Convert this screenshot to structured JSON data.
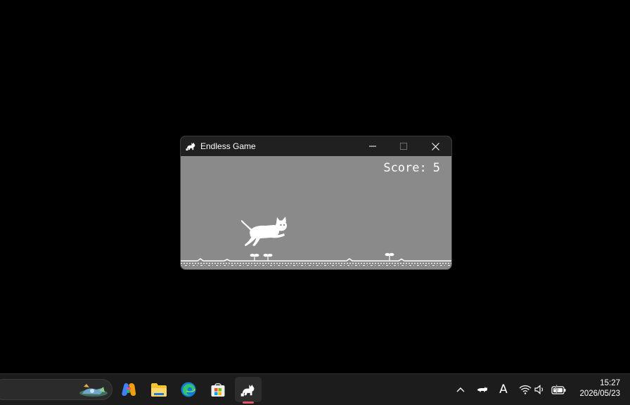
{
  "window": {
    "title": "Endless Game",
    "controls": {
      "minimize": "minimize-icon",
      "maximize": "maximize-icon",
      "close": "close-icon"
    }
  },
  "game": {
    "score_label": "Score:",
    "score_value": "5",
    "background_color": "#8a8a8a",
    "sprite_color": "#ffffff"
  },
  "taskbar": {
    "search_art": "search-highlight-icon",
    "apps": [
      {
        "name": "Copilot",
        "icon": "copilot-icon"
      },
      {
        "name": "File Explorer",
        "icon": "folder-icon"
      },
      {
        "name": "Microsoft Edge",
        "icon": "edge-icon"
      },
      {
        "name": "Microsoft Store",
        "icon": "store-icon"
      },
      {
        "name": "Endless Game",
        "icon": "cat-game-icon",
        "active": true
      }
    ],
    "active_indicator_color": "#e0575e",
    "tray": {
      "ime": "A",
      "icons": [
        "chevron-up-icon",
        "cat-tray-icon",
        "wifi-icon",
        "volume-icon",
        "battery-icon"
      ]
    },
    "clock": {
      "time": "15:27",
      "date": "2026/05/23"
    }
  }
}
